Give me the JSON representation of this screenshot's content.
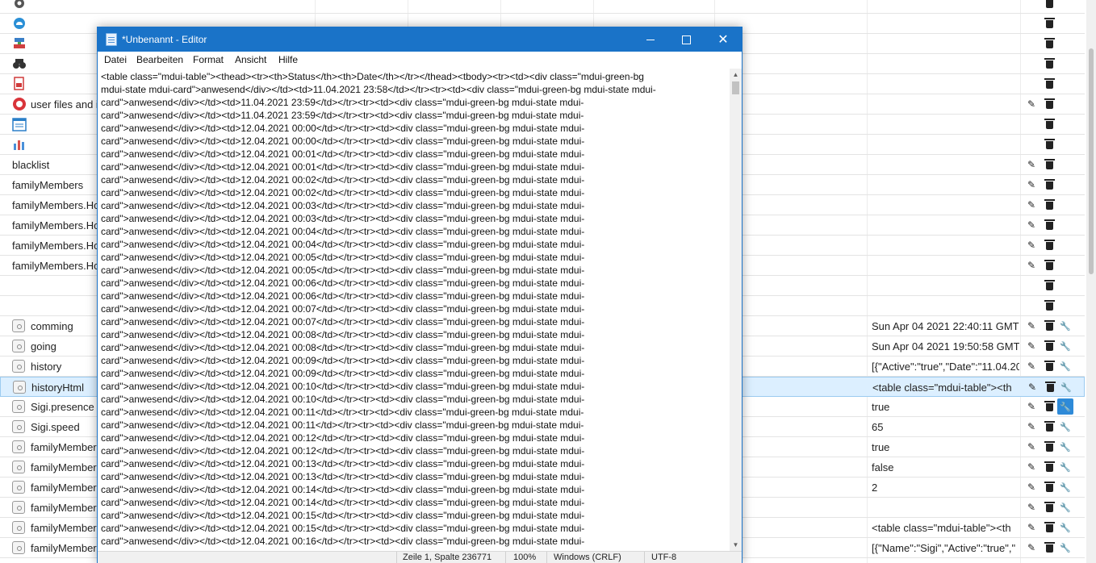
{
  "background": {
    "rows": [
      {
        "name": "",
        "icon": "gear-icon",
        "value": "",
        "actions": [
          "trash"
        ]
      },
      {
        "name": "",
        "icon": "cloud-icon",
        "value": "",
        "actions": [
          "trash"
        ]
      },
      {
        "name": "",
        "icon": "network-icon",
        "value": "",
        "actions": [
          "trash"
        ]
      },
      {
        "name": "",
        "icon": "binoculars-icon",
        "value": "",
        "actions": [
          "trash"
        ]
      },
      {
        "name": "",
        "icon": "document-red-icon",
        "value": "",
        "actions": [
          "trash"
        ]
      },
      {
        "name": "user files and i",
        "icon": "lifebuoy-icon",
        "value": "",
        "actions": [
          "pencil",
          "trash"
        ]
      },
      {
        "name": "",
        "icon": "calendar-icon",
        "value": "",
        "actions": [
          "trash"
        ]
      },
      {
        "name": "",
        "icon": "bar-chart-icon",
        "value": "",
        "actions": [
          "trash"
        ]
      },
      {
        "name": "blacklist",
        "icon": "",
        "value": "",
        "actions": [
          "pencil",
          "trash"
        ]
      },
      {
        "name": "familyMembers",
        "icon": "",
        "value": "",
        "actions": [
          "pencil",
          "trash"
        ]
      },
      {
        "name": "familyMembers.Ho",
        "icon": "",
        "value": "",
        "actions": [
          "pencil",
          "trash"
        ]
      },
      {
        "name": "familyMembers.Ho",
        "icon": "",
        "value": "",
        "actions": [
          "pencil",
          "trash"
        ]
      },
      {
        "name": "familyMembers.Ho",
        "icon": "",
        "value": "",
        "actions": [
          "pencil",
          "trash"
        ]
      },
      {
        "name": "familyMembers.Ho",
        "icon": "",
        "value": "",
        "actions": [
          "pencil",
          "trash"
        ]
      },
      {
        "name": "",
        "icon": "",
        "value": "",
        "actions": [
          "trash"
        ]
      },
      {
        "name": "",
        "icon": "",
        "value": "",
        "actions": [
          "trash"
        ]
      },
      {
        "name": "comming",
        "icon": "state-icon",
        "value": "Sun Apr 04 2021 22:40:11 GMT+",
        "actions": [
          "pencil",
          "trash",
          "wrench"
        ]
      },
      {
        "name": "going",
        "icon": "state-icon",
        "value": "Sun Apr 04 2021 19:50:58 GMT+",
        "actions": [
          "pencil",
          "trash",
          "wrench"
        ]
      },
      {
        "name": "history",
        "icon": "state-icon",
        "value": "[{\"Active\":\"true\",\"Date\":\"11.04.20",
        "actions": [
          "pencil",
          "trash",
          "wrench"
        ]
      },
      {
        "name": "historyHtml",
        "icon": "state-icon",
        "value": "<table class=\"mdui-table\"><th",
        "actions": [
          "pencil",
          "trash",
          "wrench"
        ],
        "selected": true
      },
      {
        "name": "Sigi.presence",
        "icon": "state-icon",
        "value": "true",
        "actions": [
          "pencil",
          "trash",
          "wrench-active"
        ]
      },
      {
        "name": "Sigi.speed",
        "icon": "state-icon",
        "value": "65",
        "actions": [
          "pencil",
          "trash",
          "wrench"
        ]
      },
      {
        "name": "familyMember",
        "icon": "state-icon",
        "value": "true",
        "actions": [
          "pencil",
          "trash",
          "wrench"
        ]
      },
      {
        "name": "familyMember",
        "icon": "state-icon",
        "value": "false",
        "actions": [
          "pencil",
          "trash",
          "wrench"
        ]
      },
      {
        "name": "familyMember",
        "icon": "state-icon",
        "value": "2",
        "actions": [
          "pencil",
          "trash",
          "wrench"
        ]
      },
      {
        "name": "familyMember",
        "icon": "state-icon",
        "value": "",
        "actions": [
          "pencil",
          "trash",
          "wrench"
        ]
      },
      {
        "name": "familyMember",
        "icon": "state-icon",
        "value": "<table class=\"mdui-table\"><th",
        "actions": [
          "pencil",
          "trash",
          "wrench"
        ]
      },
      {
        "name": "familyMember",
        "icon": "state-icon",
        "value": "[{\"Name\":\"Sigi\",\"Active\":\"true\",\"",
        "actions": [
          "pencil",
          "trash",
          "wrench"
        ]
      }
    ]
  },
  "editor": {
    "title": "*Unbenannt - Editor",
    "menu": [
      "Datei",
      "Bearbeiten",
      "Format",
      "Ansicht",
      "Hilfe"
    ],
    "lines": [
      "<table class=\"mdui-table\"><thead><tr><th>Status</th><th>Date</th></tr></thead><tbody><tr><td><div class=\"mdui-green-bg",
      "mdui-state mdui-card\">anwesend</div></td><td>11.04.2021 23:58</td></tr><tr><td><div class=\"mdui-green-bg mdui-state mdui-",
      "card\">anwesend</div></td><td>11.04.2021 23:59</td></tr><tr><td><div class=\"mdui-green-bg mdui-state mdui-",
      "card\">anwesend</div></td><td>11.04.2021 23:59</td></tr><tr><td><div class=\"mdui-green-bg mdui-state mdui-",
      "card\">anwesend</div></td><td>12.04.2021 00:00</td></tr><tr><td><div class=\"mdui-green-bg mdui-state mdui-",
      "card\">anwesend</div></td><td>12.04.2021 00:00</td></tr><tr><td><div class=\"mdui-green-bg mdui-state mdui-",
      "card\">anwesend</div></td><td>12.04.2021 00:01</td></tr><tr><td><div class=\"mdui-green-bg mdui-state mdui-",
      "card\">anwesend</div></td><td>12.04.2021 00:01</td></tr><tr><td><div class=\"mdui-green-bg mdui-state mdui-",
      "card\">anwesend</div></td><td>12.04.2021 00:02</td></tr><tr><td><div class=\"mdui-green-bg mdui-state mdui-",
      "card\">anwesend</div></td><td>12.04.2021 00:02</td></tr><tr><td><div class=\"mdui-green-bg mdui-state mdui-",
      "card\">anwesend</div></td><td>12.04.2021 00:03</td></tr><tr><td><div class=\"mdui-green-bg mdui-state mdui-",
      "card\">anwesend</div></td><td>12.04.2021 00:03</td></tr><tr><td><div class=\"mdui-green-bg mdui-state mdui-",
      "card\">anwesend</div></td><td>12.04.2021 00:04</td></tr><tr><td><div class=\"mdui-green-bg mdui-state mdui-",
      "card\">anwesend</div></td><td>12.04.2021 00:04</td></tr><tr><td><div class=\"mdui-green-bg mdui-state mdui-",
      "card\">anwesend</div></td><td>12.04.2021 00:05</td></tr><tr><td><div class=\"mdui-green-bg mdui-state mdui-",
      "card\">anwesend</div></td><td>12.04.2021 00:05</td></tr><tr><td><div class=\"mdui-green-bg mdui-state mdui-",
      "card\">anwesend</div></td><td>12.04.2021 00:06</td></tr><tr><td><div class=\"mdui-green-bg mdui-state mdui-",
      "card\">anwesend</div></td><td>12.04.2021 00:06</td></tr><tr><td><div class=\"mdui-green-bg mdui-state mdui-",
      "card\">anwesend</div></td><td>12.04.2021 00:07</td></tr><tr><td><div class=\"mdui-green-bg mdui-state mdui-",
      "card\">anwesend</div></td><td>12.04.2021 00:07</td></tr><tr><td><div class=\"mdui-green-bg mdui-state mdui-",
      "card\">anwesend</div></td><td>12.04.2021 00:08</td></tr><tr><td><div class=\"mdui-green-bg mdui-state mdui-",
      "card\">anwesend</div></td><td>12.04.2021 00:08</td></tr><tr><td><div class=\"mdui-green-bg mdui-state mdui-",
      "card\">anwesend</div></td><td>12.04.2021 00:09</td></tr><tr><td><div class=\"mdui-green-bg mdui-state mdui-",
      "card\">anwesend</div></td><td>12.04.2021 00:09</td></tr><tr><td><div class=\"mdui-green-bg mdui-state mdui-",
      "card\">anwesend</div></td><td>12.04.2021 00:10</td></tr><tr><td><div class=\"mdui-green-bg mdui-state mdui-",
      "card\">anwesend</div></td><td>12.04.2021 00:10</td></tr><tr><td><div class=\"mdui-green-bg mdui-state mdui-",
      "card\">anwesend</div></td><td>12.04.2021 00:11</td></tr><tr><td><div class=\"mdui-green-bg mdui-state mdui-",
      "card\">anwesend</div></td><td>12.04.2021 00:11</td></tr><tr><td><div class=\"mdui-green-bg mdui-state mdui-",
      "card\">anwesend</div></td><td>12.04.2021 00:12</td></tr><tr><td><div class=\"mdui-green-bg mdui-state mdui-",
      "card\">anwesend</div></td><td>12.04.2021 00:12</td></tr><tr><td><div class=\"mdui-green-bg mdui-state mdui-",
      "card\">anwesend</div></td><td>12.04.2021 00:13</td></tr><tr><td><div class=\"mdui-green-bg mdui-state mdui-",
      "card\">anwesend</div></td><td>12.04.2021 00:13</td></tr><tr><td><div class=\"mdui-green-bg mdui-state mdui-",
      "card\">anwesend</div></td><td>12.04.2021 00:14</td></tr><tr><td><div class=\"mdui-green-bg mdui-state mdui-",
      "card\">anwesend</div></td><td>12.04.2021 00:14</td></tr><tr><td><div class=\"mdui-green-bg mdui-state mdui-",
      "card\">anwesend</div></td><td>12.04.2021 00:15</td></tr><tr><td><div class=\"mdui-green-bg mdui-state mdui-",
      "card\">anwesend</div></td><td>12.04.2021 00:15</td></tr><tr><td><div class=\"mdui-green-bg mdui-state mdui-",
      "card\">anwesend</div></td><td>12.04.2021 00:16</td></tr><tr><td><div class=\"mdui-green-bg mdui-state mdui-"
    ],
    "status": {
      "position": "Zeile 1, Spalte 236771",
      "zoom": "100%",
      "line_ending": "Windows (CRLF)",
      "encoding": "UTF-8"
    }
  },
  "colors": {
    "titlebar": "#1a73c8",
    "selected_row": "#dcefff",
    "active_wrench": "#2e8ad8"
  }
}
